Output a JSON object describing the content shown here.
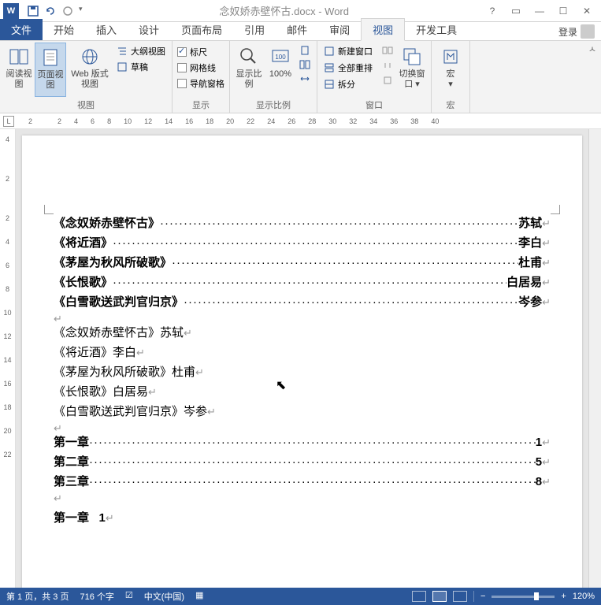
{
  "title": "念奴娇赤壁怀古.docx - Word",
  "login": "登录",
  "tabs": {
    "file": "文件",
    "items": [
      "开始",
      "插入",
      "设计",
      "页面布局",
      "引用",
      "邮件",
      "审阅",
      "视图",
      "开发工具"
    ],
    "active": "视图"
  },
  "ribbon": {
    "views": {
      "label": "视图",
      "read": "阅读视图",
      "page": "页面视图",
      "web": "Web 版式视图",
      "outline": "大纲视图",
      "draft": "草稿"
    },
    "show": {
      "label": "显示",
      "ruler": "标尺",
      "gridlines": "网格线",
      "navpane": "导航窗格"
    },
    "zoom": {
      "label": "显示比例",
      "zoom": "显示比例",
      "hundred": "100%"
    },
    "window": {
      "label": "窗口",
      "new": "新建窗口",
      "arrange": "全部重排",
      "split": "拆分",
      "switch": "切换窗口"
    },
    "macros": {
      "label": "宏",
      "btn": "宏"
    }
  },
  "ruler_h": [
    "2",
    "",
    "2",
    "4",
    "6",
    "8",
    "10",
    "12",
    "14",
    "16",
    "18",
    "20",
    "22",
    "24",
    "26",
    "28",
    "30",
    "32",
    "34",
    "36",
    "38",
    "40"
  ],
  "ruler_v": [
    "4",
    "",
    "2",
    "",
    "2",
    "4",
    "6",
    "8",
    "10",
    "12",
    "14",
    "16",
    "18",
    "20",
    "22"
  ],
  "doc": {
    "toc1": [
      {
        "title": "《念奴娇赤壁怀古》",
        "author": "苏轼"
      },
      {
        "title": "《将近酒》",
        "author": "李白"
      },
      {
        "title": "《茅屋为秋风所破歌》",
        "author": "杜甫"
      },
      {
        "title": "《长恨歌》",
        "author": "白居易"
      },
      {
        "title": "《白雪歌送武判官归京》",
        "author": "岑参"
      }
    ],
    "plain": [
      "《念奴娇赤壁怀古》苏轼",
      "《将近酒》李白",
      "《茅屋为秋风所破歌》杜甫",
      "《长恨歌》白居易",
      "《白雪歌送武判官归京》岑参"
    ],
    "toc2": [
      {
        "title": "第一章",
        "page": "1"
      },
      {
        "title": "第二章",
        "page": "5"
      },
      {
        "title": "第三章",
        "page": "8"
      }
    ],
    "chapter": "第一章",
    "chapter_num": "1"
  },
  "status": {
    "page": "第 1 页，共 3 页",
    "words": "716 个字",
    "lang": "中文(中国)",
    "zoom": "120%"
  }
}
